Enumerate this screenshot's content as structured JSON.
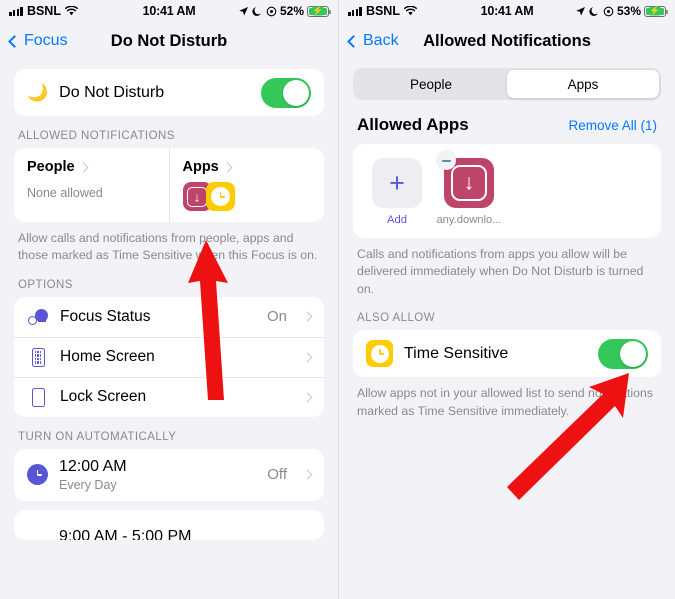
{
  "left_panel": {
    "status_bar": {
      "carrier": "BSNL",
      "time": "10:41 AM",
      "battery_pct": "52%",
      "icons": [
        "signal-bars-icon",
        "wifi-icon",
        "location-arrow-icon",
        "moon-icon",
        "focus-circle-icon",
        "battery-charging-icon"
      ]
    },
    "nav": {
      "back_label": "Focus",
      "title": "Do Not Disturb"
    },
    "dnd": {
      "label": "Do Not Disturb",
      "toggle_on": true,
      "icon": "moon-icon"
    },
    "allowed_notifications": {
      "header": "ALLOWED NOTIFICATIONS",
      "people": {
        "title": "People",
        "subtitle": "None allowed"
      },
      "apps": {
        "title": "Apps"
      },
      "footnote": "Allow calls and notifications from people, apps and those marked as Time Sensitive when this Focus is on."
    },
    "options": {
      "header": "OPTIONS",
      "rows": [
        {
          "label": "Focus Status",
          "value": "On",
          "icon": "focus-status-icon"
        },
        {
          "label": "Home Screen",
          "value": "",
          "icon": "home-screen-icon"
        },
        {
          "label": "Lock Screen",
          "value": "",
          "icon": "lock-screen-icon"
        }
      ]
    },
    "turn_on_automatically": {
      "header": "TURN ON AUTOMATICALLY",
      "rows": [
        {
          "time": "12:00 AM",
          "sub": "Every Day",
          "value": "Off",
          "icon": "clock-icon"
        }
      ],
      "partial_row_time": "9:00 AM - 5:00 PM"
    }
  },
  "right_panel": {
    "status_bar": {
      "carrier": "BSNL",
      "time": "10:41 AM",
      "battery_pct": "53%",
      "icons": [
        "signal-bars-icon",
        "wifi-icon",
        "location-arrow-icon",
        "moon-icon",
        "focus-circle-icon",
        "battery-charging-icon"
      ]
    },
    "nav": {
      "back_label": "Back",
      "title": "Allowed Notifications"
    },
    "segmented": {
      "options": [
        "People",
        "Apps"
      ],
      "selected": "Apps"
    },
    "allowed_apps": {
      "title": "Allowed Apps",
      "remove_all": "Remove All (1)",
      "add_label": "Add",
      "apps": [
        {
          "name": "any.downlo...",
          "icon": "download-app-icon",
          "has_delete_badge": true
        }
      ],
      "footnote": "Calls and notifications from apps you allow will be delivered immediately when Do Not Disturb is turned on."
    },
    "also_allow": {
      "header": "ALSO ALLOW",
      "row": {
        "label": "Time Sensitive",
        "toggle_on": true,
        "icon": "time-sensitive-clock-icon"
      },
      "footnote": "Allow apps not in your allowed list to send notifications marked as Time Sensitive immediately."
    }
  },
  "annotations": {
    "arrow_color": "#ee1111",
    "arrows": [
      {
        "name": "arrow-to-apps-cell",
        "panel": "left"
      },
      {
        "name": "arrow-to-time-sensitive-toggle",
        "panel": "right"
      }
    ]
  },
  "colors": {
    "accent_blue": "#007aff",
    "accent_purple": "#5856d6",
    "toggle_green": "#34c759",
    "app_pink": "#bf4469",
    "app_yellow": "#ffcc00",
    "page_bg": "#f2f2f7"
  }
}
